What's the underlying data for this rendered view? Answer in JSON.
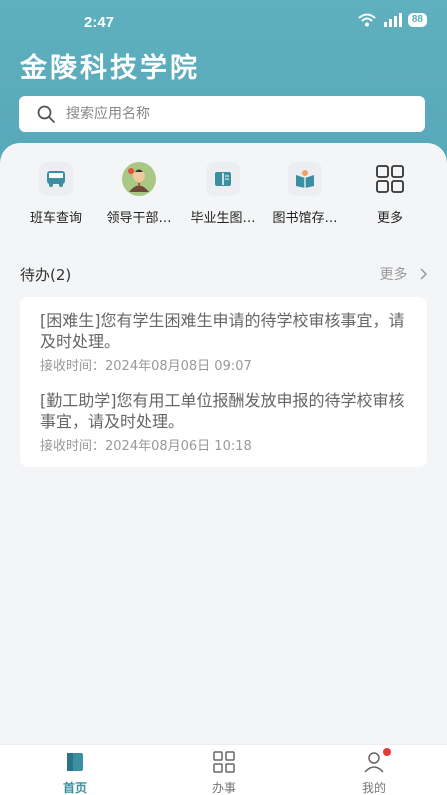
{
  "status_bar": {
    "time": "2:47",
    "battery": "88"
  },
  "header": {
    "title": "金陵科技学院"
  },
  "search": {
    "placeholder": "搜索应用名称"
  },
  "apps": [
    {
      "label": "班车查询",
      "icon": "bus-icon"
    },
    {
      "label": "领导干部…",
      "icon": "leader-avatar-icon"
    },
    {
      "label": "毕业生图…",
      "icon": "book-icon"
    },
    {
      "label": "图书馆存…",
      "icon": "library-icon"
    },
    {
      "label": "更多",
      "icon": "grid-icon"
    }
  ],
  "todo": {
    "title": "待办(2)",
    "more": "更多",
    "items": [
      {
        "text": "[困难生]您有学生困难生申请的待学校审核事宜，请及时处理。",
        "time": "接收时间：2024年08月08日 09:07"
      },
      {
        "text": "[勤工助学]您有用工单位报酬发放申报的待学校审核事宜，请及时处理。",
        "time": "接收时间：2024年08月06日 10:18"
      }
    ]
  },
  "tabbar": {
    "items": [
      {
        "label": "首页",
        "icon": "home-icon",
        "active": true
      },
      {
        "label": "办事",
        "icon": "grid-icon",
        "active": false
      },
      {
        "label": "我的",
        "icon": "user-icon",
        "active": false
      }
    ]
  },
  "colors": {
    "brand": "#5fb0bf",
    "active_tab": "#3a8fa0",
    "badge": "#e53935"
  }
}
